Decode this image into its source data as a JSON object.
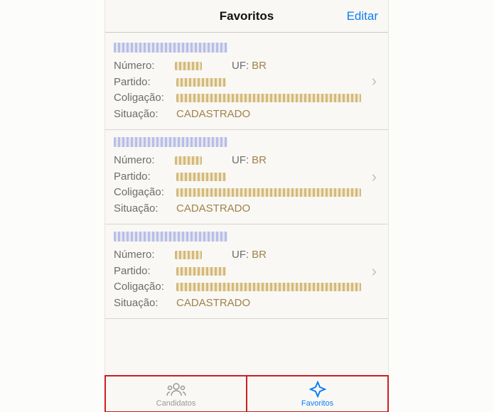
{
  "nav": {
    "title": "Favoritos",
    "edit": "Editar"
  },
  "labels": {
    "numero": "Número:",
    "uf": "UF:",
    "partido": "Partido:",
    "coligacao": "Coligação:",
    "situacao": "Situação:"
  },
  "rows": [
    {
      "uf": "BR",
      "situacao": "CADASTRADO"
    },
    {
      "uf": "BR",
      "situacao": "CADASTRADO"
    },
    {
      "uf": "BR",
      "situacao": "CADASTRADO"
    }
  ],
  "tabs": {
    "candidatos": "Candidatos",
    "favoritos": "Favoritos"
  }
}
